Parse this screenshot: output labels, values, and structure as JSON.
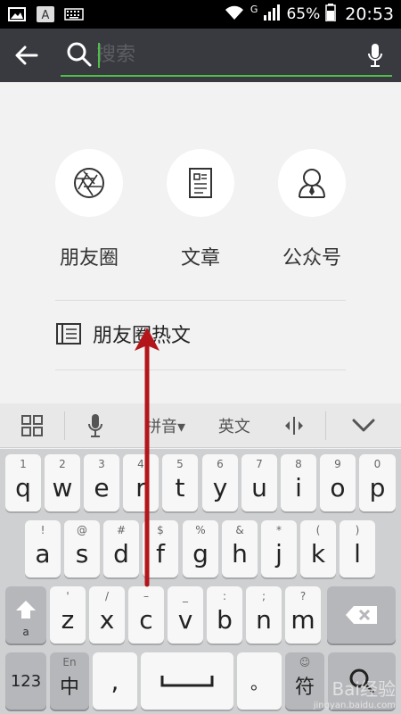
{
  "status_bar": {
    "network": "G",
    "battery": "65%",
    "time": "20:53"
  },
  "search": {
    "placeholder": "搜索"
  },
  "categories": [
    {
      "label": "朋友圈",
      "icon": "aperture-icon"
    },
    {
      "label": "文章",
      "icon": "document-icon"
    },
    {
      "label": "公众号",
      "icon": "official-account-icon"
    }
  ],
  "hot_articles": {
    "label": "朋友圈热文"
  },
  "keyboard": {
    "toolbar": {
      "pinyin": "拼音▾",
      "english": "英文"
    },
    "row1": [
      {
        "num": "1",
        "letter": "q"
      },
      {
        "num": "2",
        "letter": "w"
      },
      {
        "num": "3",
        "letter": "e"
      },
      {
        "num": "4",
        "letter": "r"
      },
      {
        "num": "5",
        "letter": "t"
      },
      {
        "num": "6",
        "letter": "y"
      },
      {
        "num": "7",
        "letter": "u"
      },
      {
        "num": "8",
        "letter": "i"
      },
      {
        "num": "9",
        "letter": "o"
      },
      {
        "num": "0",
        "letter": "p"
      }
    ],
    "row2": [
      {
        "num": "!",
        "letter": "a"
      },
      {
        "num": "@",
        "letter": "s"
      },
      {
        "num": "#",
        "letter": "d"
      },
      {
        "num": "$",
        "letter": "f"
      },
      {
        "num": "%",
        "letter": "g"
      },
      {
        "num": "&",
        "letter": "h"
      },
      {
        "num": "*",
        "letter": "j"
      },
      {
        "num": "(",
        "letter": "k"
      },
      {
        "num": ")",
        "letter": "l"
      }
    ],
    "row3": [
      {
        "num": "'",
        "letter": "z"
      },
      {
        "num": "/",
        "letter": "x"
      },
      {
        "num": "–",
        "letter": "c"
      },
      {
        "num": "_",
        "letter": "v"
      },
      {
        "num": ":",
        "letter": "b"
      },
      {
        "num": ";",
        "letter": "n"
      },
      {
        "num": "?",
        "letter": "m"
      }
    ],
    "shift_sub": "a",
    "num_key": "123",
    "lang_top": "En",
    "lang_main": "中",
    "comma": ",",
    "period": "。",
    "symbol": "符"
  },
  "watermark": {
    "line1": "Bai经验",
    "line2": "jingyan.baidu.com"
  }
}
